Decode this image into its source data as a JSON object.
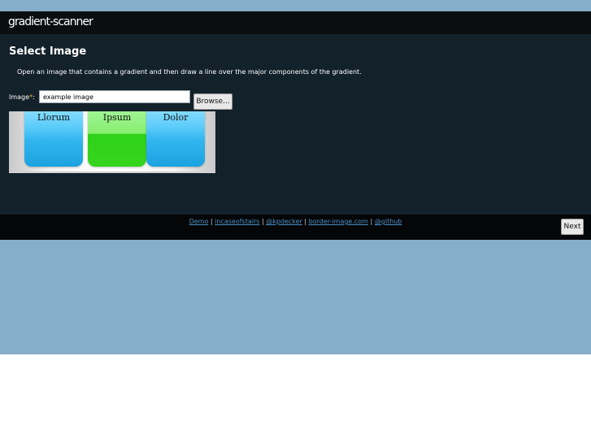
{
  "header": {
    "logo_text": "gradient-scanner"
  },
  "main": {
    "title": "Select Image",
    "instructions": "Open an image that contains a gradient and then draw a line over the major components of the gradient.",
    "image_field": {
      "label": "Image",
      "required_mark": "*",
      "label_suffix": ":",
      "value": "example image"
    },
    "browse_label": "Browse...",
    "preview": {
      "tabs": [
        {
          "label": "Llorum",
          "color": "#33b6ef"
        },
        {
          "label": "Ipsum",
          "color": "#37d51e"
        },
        {
          "label": "Dolor",
          "color": "#33b6ef"
        }
      ]
    }
  },
  "footer": {
    "links": [
      "Demo",
      "incaseofstairs",
      "@kpdecker",
      "border-image.com",
      "@github"
    ],
    "separator": " | ",
    "next_label": "Next"
  },
  "colors": {
    "background": "#86adc9",
    "header": "#0b0e10",
    "panel": "#13212a",
    "footer": "#050607",
    "link": "#4a8fc4"
  }
}
